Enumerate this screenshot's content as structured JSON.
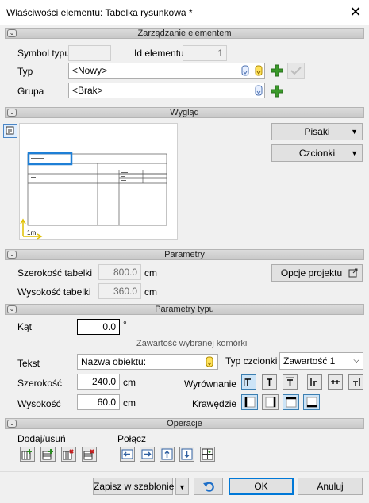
{
  "window": {
    "title": "Właściwości elementu: Tabelka rysunkowa *"
  },
  "sections": {
    "manage": "Zarządzanie elementem",
    "look": "Wygląd",
    "params": "Parametry",
    "type_params": "Parametry typu",
    "cell": "Zawartość wybranej komórki",
    "ops": "Operacje"
  },
  "manage": {
    "symbol_label": "Symbol typu",
    "symbol_value": "",
    "id_label": "Id elementu",
    "id_value": "1",
    "type_label": "Typ",
    "type_value": "<Nowy>",
    "group_label": "Grupa",
    "group_value": "<Brak>"
  },
  "look": {
    "pens_label": "Pisaki",
    "fonts_label": "Czcionki",
    "scale_label": "1m"
  },
  "params": {
    "width_label": "Szerokość tabelki",
    "width_value": "800.0",
    "width_unit": "cm",
    "height_label": "Wysokość tabelki",
    "height_value": "360.0",
    "height_unit": "cm",
    "project_options": "Opcje projektu"
  },
  "type_params": {
    "angle_label": "Kąt",
    "angle_value": "0.0",
    "angle_unit": "°"
  },
  "cell": {
    "text_label": "Tekst",
    "text_value": "Nazwa obiektu:",
    "font_type_label": "Typ czcionki",
    "font_type_value": "Zawartość 1",
    "width_label": "Szerokość",
    "width_value": "240.0",
    "width_unit": "cm",
    "height_label": "Wysokość",
    "height_value": "60.0",
    "height_unit": "cm",
    "align_label": "Wyrównanie",
    "borders_label": "Krawędzie"
  },
  "ops": {
    "add_remove_label": "Dodaj/usuń",
    "merge_label": "Połącz"
  },
  "footer": {
    "save_template": "Zapisz w szablonie",
    "ok": "OK",
    "cancel": "Anuluj"
  },
  "colors": {
    "accent": "#0078d7",
    "plus_green": "#3a9a2a",
    "preview_highlight": "#1e7fd6"
  }
}
